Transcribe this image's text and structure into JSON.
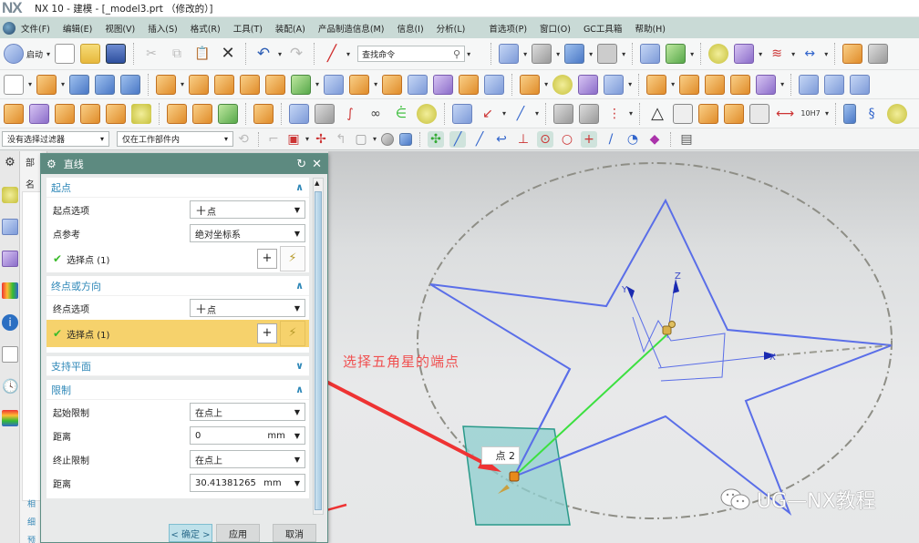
{
  "window": {
    "app_logo": "NX",
    "title": "NX 10 - 建模 - [_model3.prt （修改的）]"
  },
  "menubar": {
    "items": [
      "文件(F)",
      "编辑(E)",
      "视图(V)",
      "插入(S)",
      "格式(R)",
      "工具(T)",
      "装配(A)",
      "产品制造信息(M)",
      "信息(I)",
      "分析(L)",
      "首选项(P)",
      "窗口(O)",
      "GC工具箱",
      "帮助(H)"
    ]
  },
  "toolbar": {
    "start_label": "启动",
    "search_placeholder": "查找命令",
    "selection_filter": "没有选择过滤器",
    "selection_scope": "仅在工作部件内"
  },
  "navigator": {
    "header": "部",
    "col": "名",
    "tabs": [
      "相",
      "细",
      "预"
    ]
  },
  "dialog": {
    "title": "直线",
    "groups": {
      "start": {
        "title": "起点",
        "option_label": "起点选项",
        "option_value": "点",
        "ref_label": "点参考",
        "ref_value": "绝对坐标系",
        "select_label": "选择点 (1)"
      },
      "end": {
        "title": "终点或方向",
        "option_label": "终点选项",
        "option_value": "点",
        "select_label": "选择点 (1)"
      },
      "plane": {
        "title": "支持平面"
      },
      "limits": {
        "title": "限制",
        "start_limit_label": "起始限制",
        "start_limit_value": "在点上",
        "start_dist_label": "距离",
        "start_dist_value": "0",
        "start_dist_unit": "mm",
        "end_limit_label": "终止限制",
        "end_limit_value": "在点上",
        "end_dist_label": "距离",
        "end_dist_value": "30.41381265",
        "end_dist_unit": "mm"
      }
    },
    "buttons": {
      "ok": "< 确定 >",
      "apply": "应用",
      "cancel": "取消"
    }
  },
  "graphics": {
    "annotation": "选择五角星的端点",
    "point_label": "点 2",
    "axes": {
      "x": "X",
      "y": "Y",
      "z": "Z"
    },
    "watermark": "UG—NX教程",
    "colors": {
      "curve": "#5a6ee8",
      "line_preview": "#3ce040",
      "arrow": "#ee3333",
      "plane": "#8fcfcf"
    }
  }
}
